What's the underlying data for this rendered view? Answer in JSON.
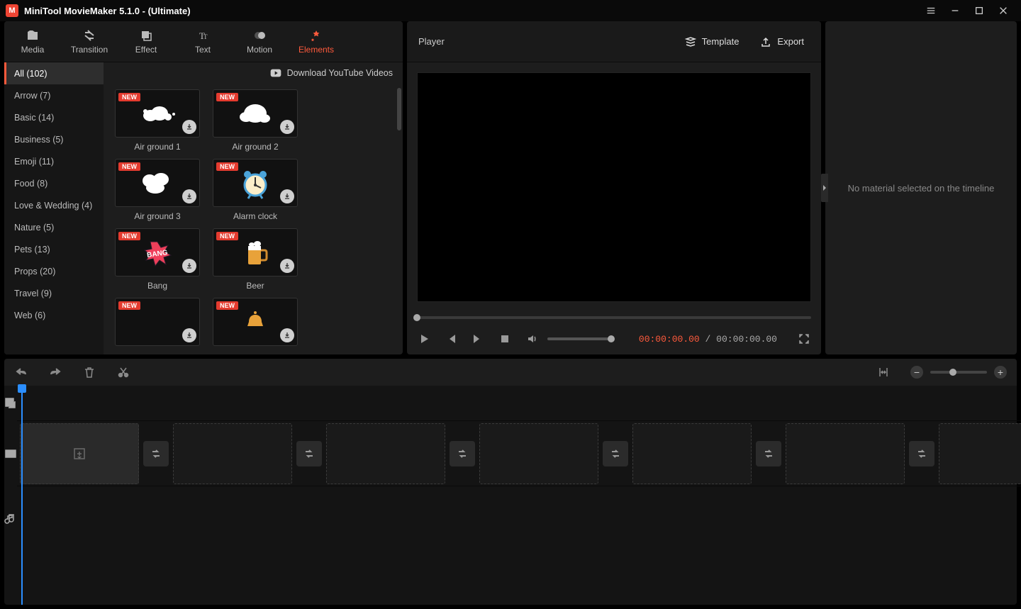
{
  "titlebar": {
    "title": "MiniTool MovieMaker 5.1.0 - (Ultimate)"
  },
  "tabs": [
    {
      "id": "media",
      "label": "Media"
    },
    {
      "id": "transition",
      "label": "Transition"
    },
    {
      "id": "effect",
      "label": "Effect"
    },
    {
      "id": "text",
      "label": "Text"
    },
    {
      "id": "motion",
      "label": "Motion"
    },
    {
      "id": "elements",
      "label": "Elements",
      "active": true
    }
  ],
  "dl_link": "Download YouTube Videos",
  "categories": [
    {
      "label": "All (102)",
      "active": true
    },
    {
      "label": "Arrow (7)"
    },
    {
      "label": "Basic (14)"
    },
    {
      "label": "Business (5)"
    },
    {
      "label": "Emoji (11)"
    },
    {
      "label": "Food (8)"
    },
    {
      "label": "Love & Wedding (4)"
    },
    {
      "label": "Nature (5)"
    },
    {
      "label": "Pets (13)"
    },
    {
      "label": "Props (20)"
    },
    {
      "label": "Travel (9)"
    },
    {
      "label": "Web (6)"
    }
  ],
  "new_badge": "NEW",
  "thumbs": [
    {
      "label": "Air ground 1",
      "art": "cloud1"
    },
    {
      "label": "Air ground 2",
      "art": "cloud2"
    },
    {
      "label": "Air ground 3",
      "art": "cloud3"
    },
    {
      "label": "Alarm clock",
      "art": "clock"
    },
    {
      "label": "Bang",
      "art": "bang"
    },
    {
      "label": "Beer",
      "art": "beer"
    },
    {
      "label": "",
      "art": "blank"
    },
    {
      "label": "",
      "art": "bell"
    }
  ],
  "player": {
    "title": "Player",
    "template_label": "Template",
    "export_label": "Export",
    "current_time": "00:00:00.00",
    "separator": "/",
    "total_time": "00:00:00.00"
  },
  "right": {
    "message": "No material selected on the timeline"
  }
}
